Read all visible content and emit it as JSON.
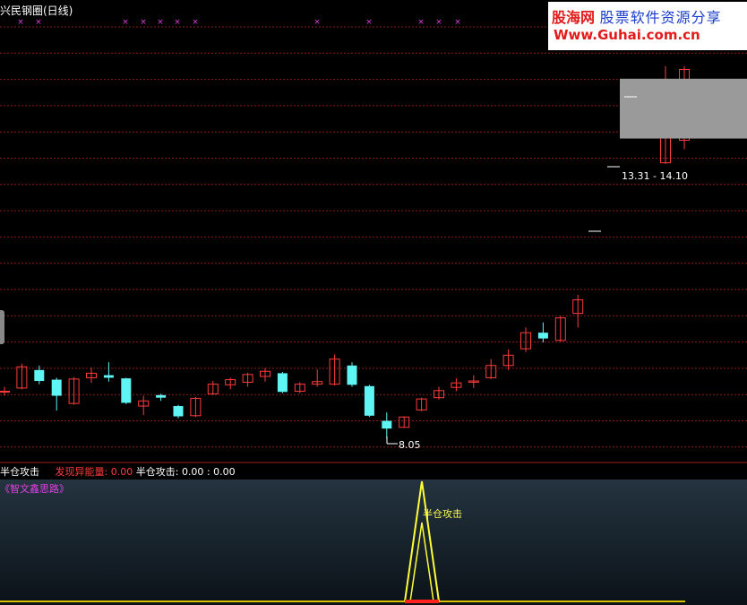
{
  "title": "兴民钢圈(日线)",
  "watermark": {
    "brand": "股海网",
    "slogan": "股票软件资源分享",
    "url": "Www.Guhai.com.cn"
  },
  "range_label": "13.31 - 14.10",
  "low_label": "8.05",
  "indicator": {
    "name": "半仓攻击",
    "field1_label": "发现异能量:",
    "field1_value": "0.00",
    "field2_label": "半仓攻击:",
    "field2_value": "0.00",
    "field2_sep": ":",
    "field3_value": "0.00"
  },
  "watermark2": "《智文鑫思路》",
  "signal_label": "半仓攻击",
  "colors": {
    "up": "#ff3b3b",
    "down": "#5ff5f5",
    "grid": "#8a1c1c",
    "signal": "#ffff33"
  },
  "chart_data": {
    "type": "candlestick",
    "price_range": [
      7.4,
      14.6
    ],
    "candles": [
      {
        "o": 9.55,
        "c": 9.55,
        "h": 9.62,
        "l": 9.48
      },
      {
        "o": 9.6,
        "c": 9.93,
        "h": 9.98,
        "l": 9.58
      },
      {
        "o": 9.88,
        "c": 9.71,
        "h": 9.95,
        "l": 9.66
      },
      {
        "o": 9.73,
        "c": 9.48,
        "h": 9.76,
        "l": 9.25
      },
      {
        "o": 9.36,
        "c": 9.74,
        "h": 9.77,
        "l": 9.34
      },
      {
        "o": 9.76,
        "c": 9.83,
        "h": 9.92,
        "l": 9.68
      },
      {
        "o": 9.8,
        "c": 9.76,
        "h": 10.0,
        "l": 9.7
      },
      {
        "o": 9.75,
        "c": 9.37,
        "h": 9.76,
        "l": 9.35
      },
      {
        "o": 9.32,
        "c": 9.4,
        "h": 9.48,
        "l": 9.18
      },
      {
        "o": 9.49,
        "c": 9.45,
        "h": 9.51,
        "l": 9.4
      },
      {
        "o": 9.32,
        "c": 9.16,
        "h": 9.34,
        "l": 9.13
      },
      {
        "o": 9.17,
        "c": 9.44,
        "h": 9.46,
        "l": 9.15
      },
      {
        "o": 9.51,
        "c": 9.66,
        "h": 9.71,
        "l": 9.49
      },
      {
        "o": 9.65,
        "c": 9.73,
        "h": 9.76,
        "l": 9.58
      },
      {
        "o": 9.69,
        "c": 9.81,
        "h": 9.84,
        "l": 9.62
      },
      {
        "o": 9.78,
        "c": 9.86,
        "h": 9.91,
        "l": 9.7
      },
      {
        "o": 9.83,
        "c": 9.54,
        "h": 9.85,
        "l": 9.52
      },
      {
        "o": 9.55,
        "c": 9.66,
        "h": 9.69,
        "l": 9.52
      },
      {
        "o": 9.66,
        "c": 9.7,
        "h": 9.89,
        "l": 9.62
      },
      {
        "o": 9.66,
        "c": 10.05,
        "h": 10.12,
        "l": 9.64
      },
      {
        "o": 9.95,
        "c": 9.65,
        "h": 10.0,
        "l": 9.62
      },
      {
        "o": 9.63,
        "c": 9.17,
        "h": 9.65,
        "l": 9.15
      },
      {
        "o": 9.09,
        "c": 8.97,
        "h": 9.22,
        "l": 8.81
      },
      {
        "o": 8.99,
        "c": 9.15,
        "h": 9.16,
        "l": 8.98
      },
      {
        "o": 9.26,
        "c": 9.43,
        "h": 9.45,
        "l": 9.24
      },
      {
        "o": 9.45,
        "c": 9.56,
        "h": 9.62,
        "l": 9.42
      },
      {
        "o": 9.61,
        "c": 9.68,
        "h": 9.75,
        "l": 9.55
      },
      {
        "o": 9.69,
        "c": 9.71,
        "h": 9.8,
        "l": 9.6
      },
      {
        "o": 9.76,
        "c": 9.95,
        "h": 10.05,
        "l": 9.74
      },
      {
        "o": 9.95,
        "c": 10.11,
        "h": 10.2,
        "l": 9.88
      },
      {
        "o": 10.21,
        "c": 10.46,
        "h": 10.54,
        "l": 10.16
      },
      {
        "o": 10.46,
        "c": 10.37,
        "h": 10.62,
        "l": 10.31
      },
      {
        "o": 10.34,
        "c": 10.69,
        "h": 10.72,
        "l": 10.32
      },
      {
        "o": 10.76,
        "c": 10.97,
        "h": 11.05,
        "l": 10.54
      },
      {
        "o": 13.1,
        "c": 13.9,
        "h": 14.6,
        "l": 13.08
      },
      {
        "o": 13.45,
        "c": 14.55,
        "h": 14.6,
        "l": 13.31
      }
    ],
    "range_box": [
      13.31,
      14.1
    ],
    "low_marker": 8.05,
    "indicator_spike": 1.0
  }
}
